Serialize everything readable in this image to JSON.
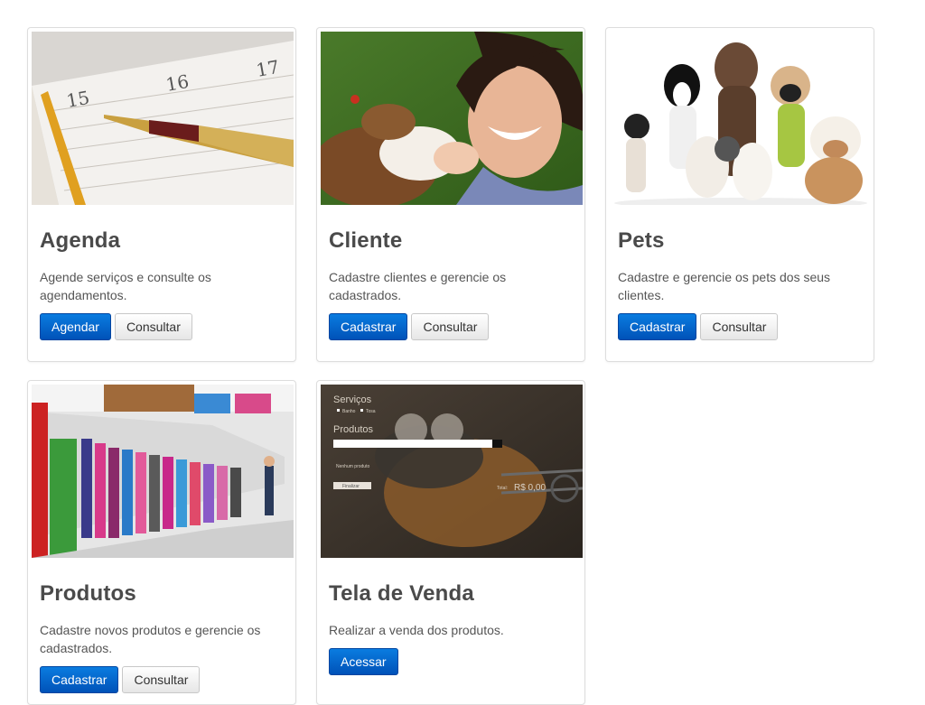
{
  "cards": [
    {
      "title": "Agenda",
      "description": "Agende serviços e consulte os agendamentos.",
      "primary_label": "Agendar",
      "secondary_label": "Consultar",
      "image": "calendar-with-pen"
    },
    {
      "title": "Cliente",
      "description": "Cadastre clientes e gerencie os cadastrados.",
      "primary_label": "Cadastrar",
      "secondary_label": "Consultar",
      "image": "woman-with-dog"
    },
    {
      "title": "Pets",
      "description": "Cadastre e gerencie os pets dos seus clientes.",
      "primary_label": "Cadastrar",
      "secondary_label": "Consultar",
      "image": "group-of-dogs"
    },
    {
      "title": "Produtos",
      "description": "Cadastre novos produtos e gerencie os cadastrados.",
      "primary_label": "Cadastrar",
      "secondary_label": "Consultar",
      "image": "pet-store-aisle"
    },
    {
      "title": "Tela de Venda",
      "description": "Realizar a venda dos produtos.",
      "primary_label": "Acessar",
      "image": "sales-screen-preview",
      "preview": {
        "services_label": "Serviços",
        "service_1": "Banho",
        "service_2": "Tosa",
        "products_label": "Produtos",
        "no_products": "Nenhum produto",
        "finish_label": "Finalizar",
        "total_label": "Total:",
        "total_value": "R$ 0,00"
      }
    }
  ],
  "colors": {
    "primary_button": "#0062c9",
    "title_text": "#4a4a4a",
    "card_border": "#dddddd"
  }
}
